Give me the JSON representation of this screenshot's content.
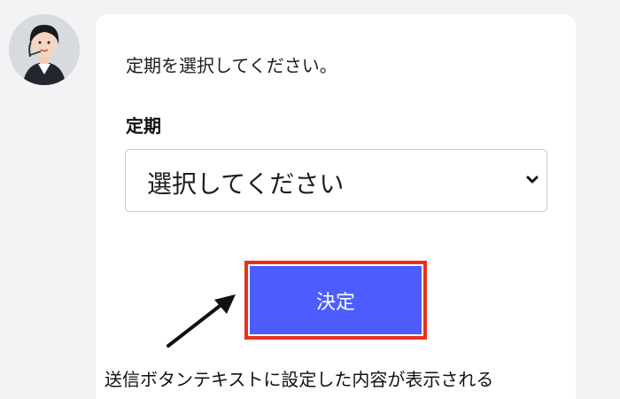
{
  "avatar": {
    "icon": "operator-avatar-icon"
  },
  "card": {
    "prompt": "定期を選択してください。",
    "field_label": "定期",
    "select": {
      "selected": "選択してください",
      "icon": "chevron-down-icon"
    },
    "submit_label": "決定"
  },
  "annotation": {
    "caption": "送信ボタンテキストに設定した内容が表示される",
    "highlight_color": "#e8321c",
    "icon": "arrow-icon"
  },
  "colors": {
    "accent": "#4c5cff",
    "background": "#f3f3f5",
    "card": "#ffffff"
  }
}
